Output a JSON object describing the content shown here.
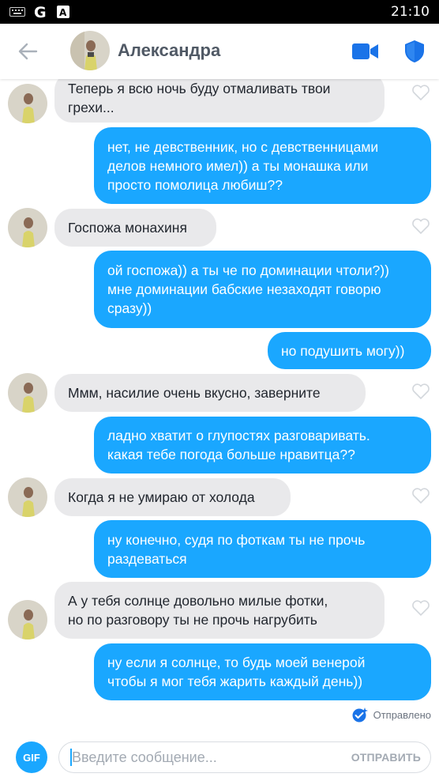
{
  "status_bar": {
    "time": "21:10"
  },
  "header": {
    "name": "Александра"
  },
  "messages": [
    {
      "side": "in",
      "text_lines": [
        "Теперь я всю ночь буду отмаливать твои",
        "грехи..."
      ]
    },
    {
      "side": "out",
      "text_lines": [
        "нет, не девственник, но с девственницами",
        "делов немного имел)) а ты монашка или",
        "просто помолица любиш??"
      ]
    },
    {
      "side": "in",
      "text_lines": [
        "Госпожа монахиня"
      ]
    },
    {
      "side": "out",
      "text_lines": [
        "ой госпожа)) а ты че по доминации чтоли?))",
        "мне доминации бабские незаходят говорю",
        "сразу))"
      ]
    },
    {
      "side": "out",
      "text_lines": [
        "но подушить могу))"
      ]
    },
    {
      "side": "in",
      "text_lines": [
        "Ммм, насилие очень вкусно, заверните"
      ]
    },
    {
      "side": "out",
      "text_lines": [
        "ладно хватит о глупостях разговаривать.",
        "какая тебе погода больше нравитца??"
      ]
    },
    {
      "side": "in",
      "text_lines": [
        "Когда я не умираю от холода"
      ]
    },
    {
      "side": "out",
      "text_lines": [
        "ну конечно, судя по фоткам ты не прочь",
        "раздеваться"
      ]
    },
    {
      "side": "in",
      "text_lines": [
        "А у тебя солнце довольно милые фотки,",
        "но по разговору ты не прочь нагрубить"
      ]
    },
    {
      "side": "out",
      "text_lines": [
        "ну если я солнце, то будь моей  венерой",
        "чтобы я мог тебя жарить каждый день))"
      ]
    }
  ],
  "sent_status": "Отправлено",
  "composer": {
    "gif_label": "GIF",
    "placeholder": "Введите сообщение...",
    "send_label": "ОТПРАВИТЬ"
  },
  "colors": {
    "outgoing_bubble": "#1aa7ff",
    "incoming_bubble": "#e9e9eb",
    "accent": "#1aa7ff"
  }
}
